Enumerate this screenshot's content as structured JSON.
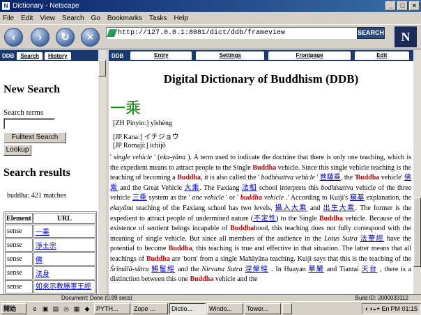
{
  "window": {
    "title": "Dictionary - Netscape",
    "minimize": "_",
    "maximize": "□",
    "close": "×"
  },
  "menu": [
    "File",
    "Edit",
    "View",
    "Search",
    "Go",
    "Bookmarks",
    "Tasks",
    "Help"
  ],
  "nav": {
    "back": "‹",
    "forward": "›",
    "reload": "↻",
    "stop": "×",
    "url": "http://127.0.0.1:8081/dict/ddb/frameview",
    "search_label": "SEARCH",
    "logo": "N"
  },
  "left": {
    "tab_label": "DDB",
    "tabs": [
      "Search",
      "History"
    ],
    "new_search": "New Search",
    "search_terms_label": "Search terms",
    "fulltext_button": "Fulltext Search",
    "lookup_button": "Lookup",
    "results_heading": "Search results",
    "match_count": "buddha: 421 matches",
    "table_headers": [
      "Element",
      "URL"
    ],
    "rows": [
      {
        "element": "sense",
        "url": "一乘"
      },
      {
        "element": "sense",
        "url": "淨土宗"
      },
      {
        "element": "sense",
        "url": "佛"
      },
      {
        "element": "sense",
        "url": "法身"
      },
      {
        "element": "sense",
        "url": "如來示教勝軍王經"
      }
    ]
  },
  "right": {
    "tab_label": "DDB",
    "tabs": [
      "Entry",
      "Settings",
      "Frontpage",
      "Edit"
    ],
    "title": "Digital Dictionary of Buddhism (DDB)",
    "headword": "一乘",
    "readings": [
      "[ZH Pinyin:] yīshèng",
      "[JP Kana:] イチジョウ",
      "[JP Romaji:] ichijō"
    ],
    "body": [
      {
        "t": "' "
      },
      {
        "t": "single vehicle",
        "i": true
      },
      {
        "t": " ' ("
      },
      {
        "t": "eka-yāna",
        "i": true
      },
      {
        "t": " ). A term used to indicate the doctrine that there is only one teaching, which is the expedient means to attract people to the Single "
      },
      {
        "t": "Buddha",
        "b": true
      },
      {
        "t": " vehicle. Since this single vehicle teaching is the teaching of becoming a "
      },
      {
        "t": "Buddha",
        "b": true
      },
      {
        "t": ", it is also called the ' "
      },
      {
        "t": "bodhisattva vehicle",
        "i": true
      },
      {
        "t": " ' "
      },
      {
        "t": "菩薩乘",
        "l": true
      },
      {
        "t": ", the '"
      },
      {
        "t": "Buddha",
        "b": true
      },
      {
        "t": " vehicle' "
      },
      {
        "t": "佛乘",
        "l": true
      },
      {
        "t": " and the Great Vehicle "
      },
      {
        "t": "大乘",
        "l": true
      },
      {
        "t": ". The Faxiang "
      },
      {
        "t": "法相",
        "l": true
      },
      {
        "t": " school interprets this "
      },
      {
        "t": "bodhisattva",
        "i": true
      },
      {
        "t": " vehicle of the three vehicle "
      },
      {
        "t": "三乘",
        "l": true
      },
      {
        "t": " system as the ' "
      },
      {
        "t": "one vehicle",
        "i": true
      },
      {
        "t": " ' or ' "
      },
      {
        "t": "buddha",
        "b": true,
        "i": true
      },
      {
        "t": " vehicle",
        "i": true
      },
      {
        "t": " .' According to Kuiji's "
      },
      {
        "t": "窺基",
        "l": true
      },
      {
        "t": " explanation, the "
      },
      {
        "t": "ekayāna",
        "i": true
      },
      {
        "t": " teaching of the Faxiang school has two levels, "
      },
      {
        "t": "攝入大乘",
        "l": true
      },
      {
        "t": " and "
      },
      {
        "t": "出生大乘",
        "l": true
      },
      {
        "t": ". The former is the expedient to attract people of undermined nature ("
      },
      {
        "t": "不定性",
        "l": true
      },
      {
        "t": ") to the Single "
      },
      {
        "t": "Buddha",
        "b": true
      },
      {
        "t": " vehicle. Because of the existence of sentient beings incapable of "
      },
      {
        "t": "Buddha",
        "b": true
      },
      {
        "t": "hood, this teaching does not fully correspond with the meaning of single vehicle. But since all members of the audience in the "
      },
      {
        "t": "Lotus Sutra",
        "i": true
      },
      {
        "t": " "
      },
      {
        "t": "法華經",
        "l": true
      },
      {
        "t": " have the potential to become "
      },
      {
        "t": "Buddha",
        "b": true
      },
      {
        "t": ", this teaching is true and effective in that situation. The latter means that all teachings of "
      },
      {
        "t": "Buddha",
        "b": true
      },
      {
        "t": " are 'born' from a single Mahāyāna teaching. Kuiji says that this is the teaching of the "
      },
      {
        "t": "Śrīmālā-sūtra",
        "i": true
      },
      {
        "t": " "
      },
      {
        "t": "勝鬘經",
        "l": true
      },
      {
        "t": " and the "
      },
      {
        "t": "Nirvana Sutra",
        "i": true
      },
      {
        "t": " "
      },
      {
        "t": "涅槃經",
        "l": true
      },
      {
        "t": " . In Huayan "
      },
      {
        "t": "華嚴",
        "l": true
      },
      {
        "t": " and Tiantai "
      },
      {
        "t": "天台",
        "l": true
      },
      {
        "t": " , there is a distinction between this one "
      },
      {
        "t": "Buddha",
        "b": true
      },
      {
        "t": " vehicle and the"
      }
    ]
  },
  "status": {
    "left": "Document: Done (0.99 secs)",
    "right": "Build ID: 2000033112"
  },
  "taskbar": {
    "start": "開始",
    "tasks": [
      "PYTH...",
      "Zope ...",
      "Dictio...",
      "Windo...",
      "Tower...",
      ""
    ],
    "active_task": 2,
    "clock": "PM 01:15",
    "lang": "En"
  }
}
